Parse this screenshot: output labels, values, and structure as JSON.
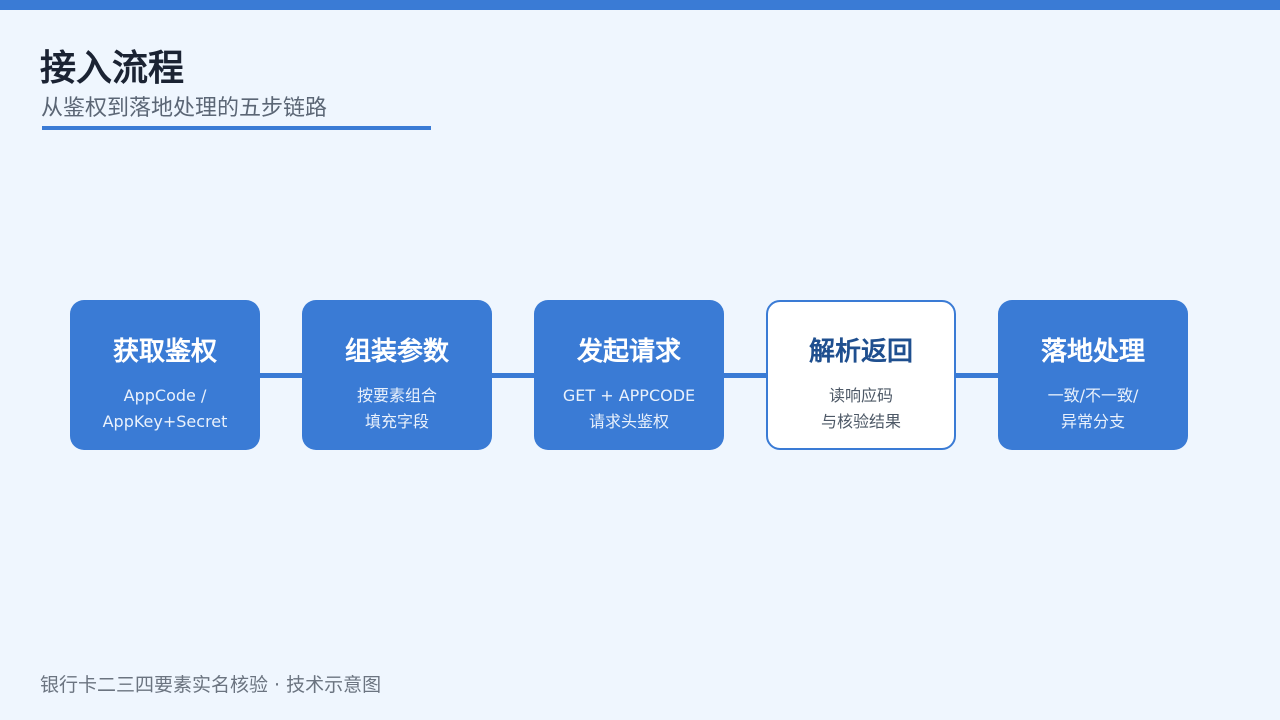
{
  "header": {
    "title": "接入流程",
    "subtitle": "从鉴权到落地处理的五步链路"
  },
  "steps": [
    {
      "title": "获取鉴权",
      "lines": [
        "AppCode /",
        "AppKey+Secret"
      ]
    },
    {
      "title": "组装参数",
      "lines": [
        "按要素组合",
        "填充字段"
      ]
    },
    {
      "title": "发起请求",
      "lines": [
        "GET + APPCODE",
        "请求头鉴权"
      ]
    },
    {
      "title": "解析返回",
      "lines": [
        "读响应码",
        "与核验结果"
      ],
      "highlighted": true
    },
    {
      "title": "落地处理",
      "lines": [
        "一致/不一致/",
        "异常分支"
      ]
    }
  ],
  "footer": {
    "text": "银行卡二三四要素实名核验 · 技术示意图"
  },
  "colors": {
    "accent": "#3a7bd5",
    "background": "#eff6fe",
    "title_text": "#1b2333",
    "highlight_title": "#1f4f8f"
  }
}
